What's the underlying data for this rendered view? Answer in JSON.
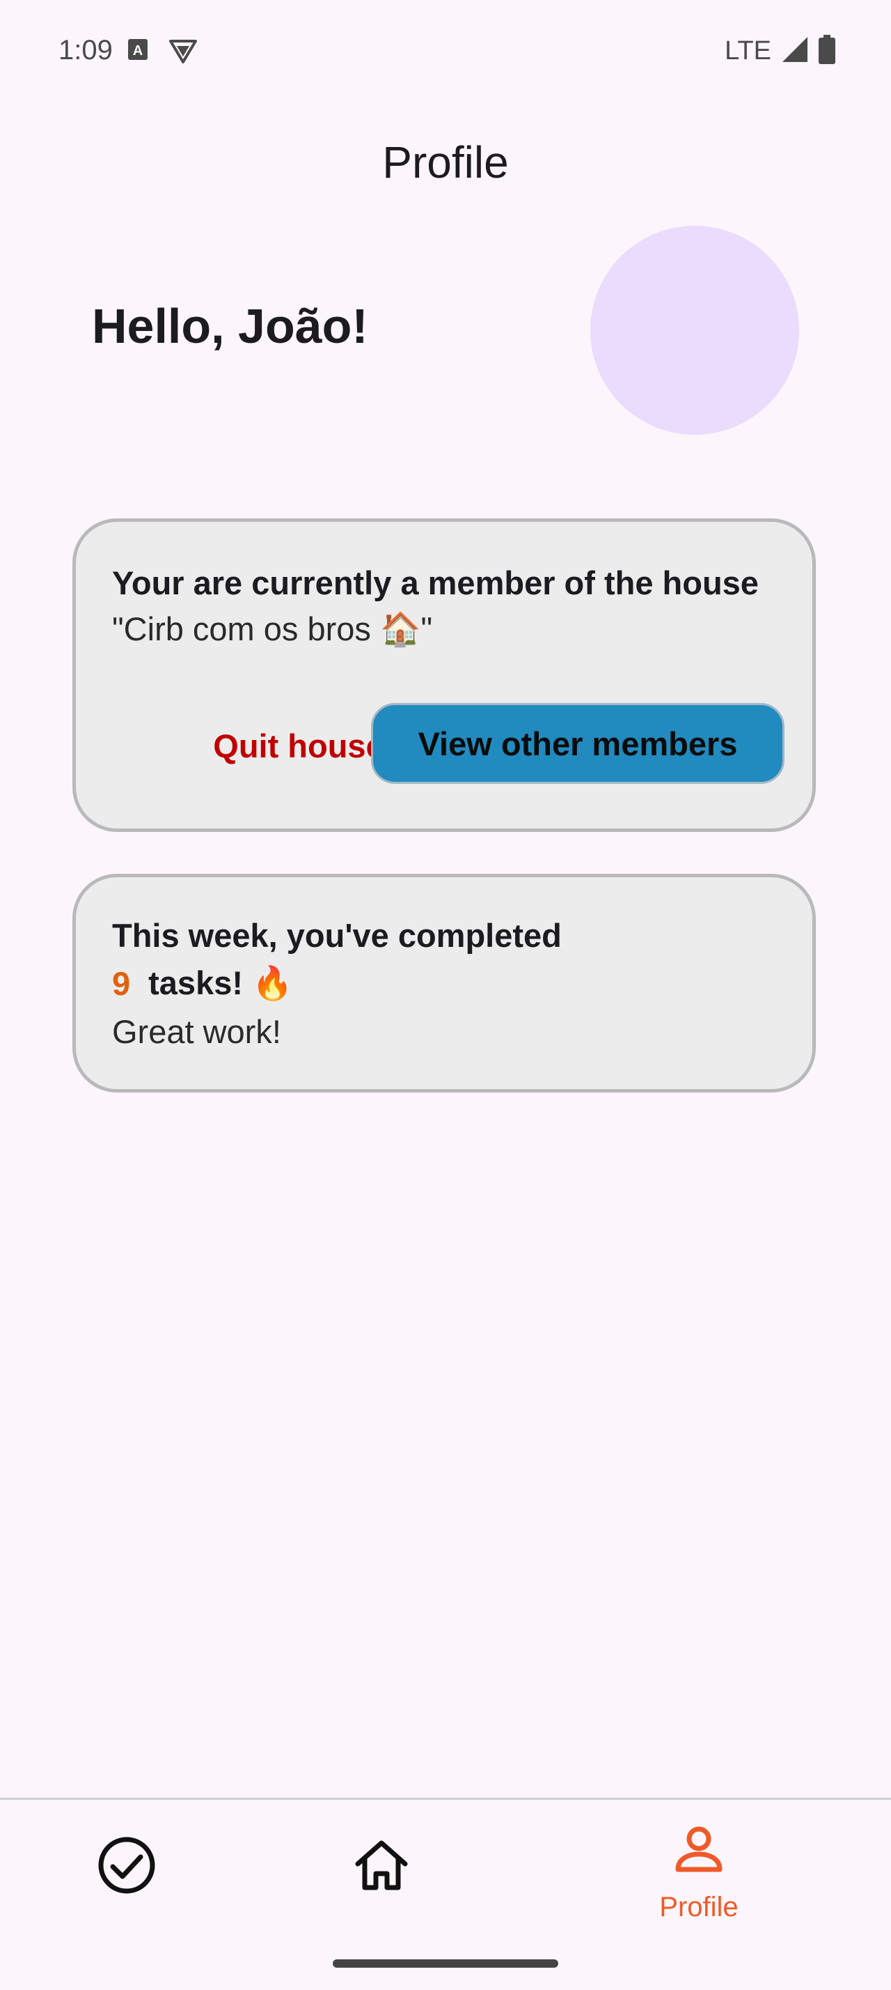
{
  "status_bar": {
    "time": "1:09",
    "network": "LTE"
  },
  "header": {
    "title": "Profile"
  },
  "greeting": "Hello, João!",
  "house_card": {
    "heading": "Your are currently a member of the house",
    "house_name": "\"Cirb com os bros 🏠\"",
    "quit_label": "Quit house",
    "view_members_label": "View other members"
  },
  "stats_card": {
    "line1": "This week, you've completed",
    "count": "9",
    "tasks_text": "tasks! 🔥",
    "praise": "Great work!"
  },
  "bottom_nav": {
    "items": [
      {
        "icon": "check-circle-icon",
        "label": ""
      },
      {
        "icon": "home-icon",
        "label": ""
      },
      {
        "icon": "person-icon",
        "label": "Profile",
        "active": true
      }
    ]
  },
  "colors": {
    "background": "#fcf6fc",
    "accent": "#f05a28",
    "danger": "#c00000",
    "primary_button": "#218abe",
    "avatar": "#e9dcfd"
  }
}
